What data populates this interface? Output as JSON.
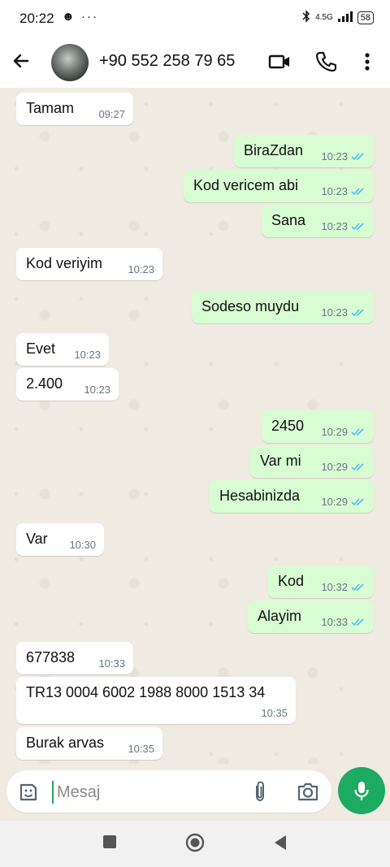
{
  "status_bar": {
    "time": "20:22",
    "left_icons": "☻ ···",
    "network": "4.5G",
    "battery": "58"
  },
  "header": {
    "contact_name": "+90 552 258 79 65",
    "back_icon": "arrow-left-icon",
    "video_icon": "video-camera-icon",
    "call_icon": "phone-icon",
    "menu_icon": "more-vert-icon"
  },
  "messages": [
    {
      "dir": "in",
      "text": "Tamam",
      "time": "09:27"
    },
    {
      "dir": "out",
      "text": "BiraZdan",
      "time": "10:23"
    },
    {
      "dir": "out",
      "text": "Kod vericem abi",
      "time": "10:23"
    },
    {
      "dir": "out",
      "text": "Sana",
      "time": "10:23"
    },
    {
      "dir": "in",
      "text": "Kod veriyim",
      "time": "10:23"
    },
    {
      "dir": "out",
      "text": "Sodeso muydu",
      "time": "10:23"
    },
    {
      "dir": "in",
      "text": "Evet",
      "time": "10:23"
    },
    {
      "dir": "in",
      "text": "2.400",
      "time": "10:23"
    },
    {
      "dir": "out",
      "text": "2450",
      "time": "10:29"
    },
    {
      "dir": "out",
      "text": "Var mi",
      "time": "10:29"
    },
    {
      "dir": "out",
      "text": "Hesabinizda",
      "time": "10:29"
    },
    {
      "dir": "in",
      "text": "Var",
      "time": "10:30"
    },
    {
      "dir": "out",
      "text": "Kod",
      "time": "10:32"
    },
    {
      "dir": "out",
      "text": "Alayim",
      "time": "10:33"
    },
    {
      "dir": "in",
      "text": "677838",
      "time": "10:33"
    },
    {
      "dir": "in",
      "text": "TR13 0004 6002 1988 8000 1513 34",
      "time": "10:35"
    },
    {
      "dir": "in",
      "text": "Burak arvas",
      "time": "10:35"
    }
  ],
  "input": {
    "placeholder": "Mesaj",
    "value": ""
  },
  "colors": {
    "accent": "#1daa61",
    "outgoing_bubble": "#d9fdd3",
    "incoming_bubble": "#ffffff",
    "chat_background": "#efeae2",
    "read_ticks": "#53bdeb"
  }
}
